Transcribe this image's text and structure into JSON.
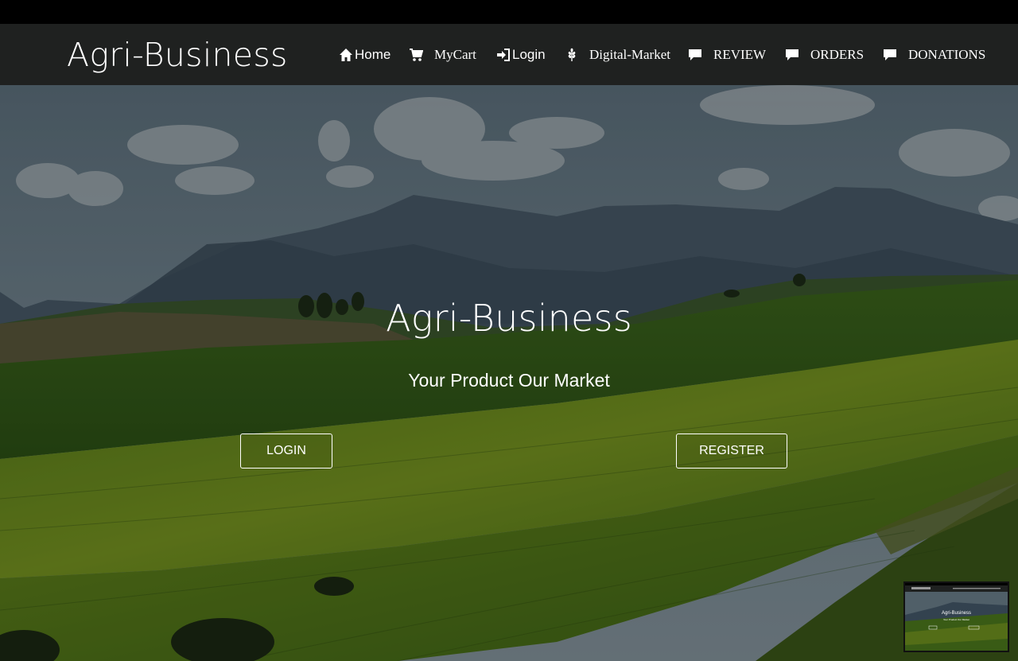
{
  "header": {
    "brand": "Agri-Business",
    "nav": [
      {
        "label": "Home",
        "icon": "home-icon"
      },
      {
        "label": "MyCart",
        "icon": "cart-icon"
      },
      {
        "label": "Login",
        "icon": "login-icon"
      },
      {
        "label": "Digital-Market",
        "icon": "wheat-icon"
      },
      {
        "label": "REVIEW",
        "icon": "comment-icon"
      },
      {
        "label": "ORDERS",
        "icon": "comment-icon"
      },
      {
        "label": "DONATIONS",
        "icon": "comment-icon"
      }
    ]
  },
  "hero": {
    "title": "Agri-Business",
    "subtitle": "Your Product Our Market",
    "login_label": "LOGIN",
    "register_label": "REGISTER"
  },
  "thumbnail": {
    "title": "Agri-Business",
    "subtitle": "Your Product Our Market"
  },
  "colors": {
    "navbar": "#1f2120",
    "topstrip": "#000000",
    "text": "#ffffff",
    "sky": "#6f8591",
    "field": "#4f7a1c"
  }
}
